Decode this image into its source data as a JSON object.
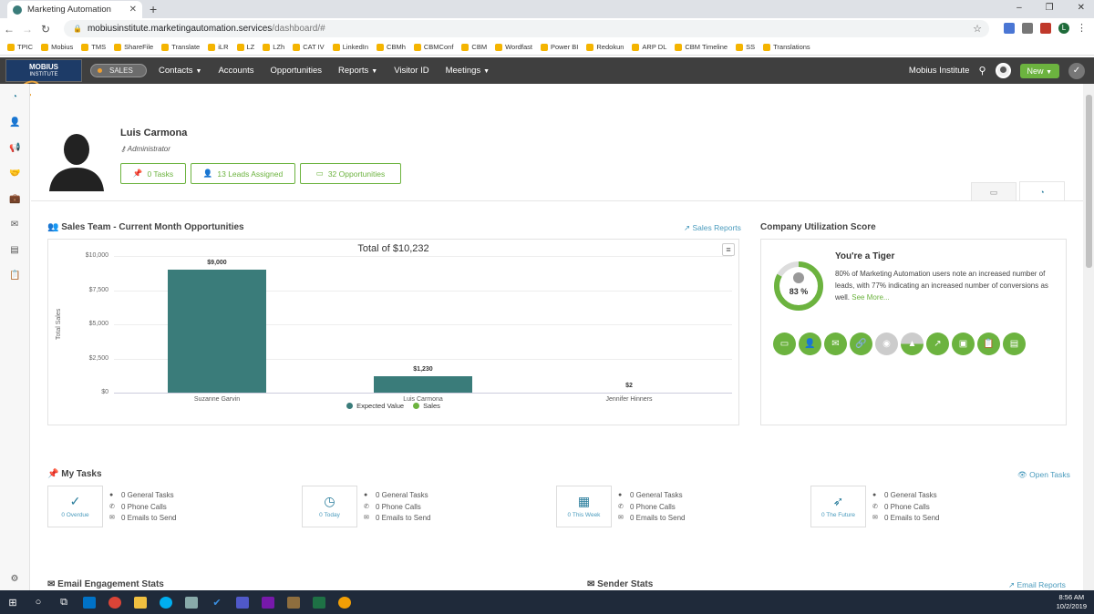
{
  "browser": {
    "tab_title": "Marketing Automation",
    "new_tab": "+",
    "window_controls": [
      "–",
      "❐",
      "✕"
    ],
    "url_host": "mobiusinstitute.marketingautomation.services",
    "url_path": "/dashboard/#",
    "bookmarks": [
      "TPIC",
      "Mobius",
      "TMS",
      "ShareFile",
      "Translate",
      "iLR",
      "LZ",
      "LZh",
      "CAT IV",
      "LinkedIn",
      "CBMh",
      "CBMConf",
      "CBM",
      "Wordfast",
      "Power BI",
      "Redokun",
      "ARP DL",
      "CBM Timeline",
      "SS",
      "Translations"
    ],
    "profile_initial": "L"
  },
  "appnav": {
    "logo_top": "MOBIUS",
    "logo_bottom": "INSTITUTE",
    "sales_pill": "SALES",
    "items": [
      "Contacts",
      "Accounts",
      "Opportunities",
      "Reports",
      "Visitor ID",
      "Meetings"
    ],
    "org": "Mobius Institute",
    "new_button": "New"
  },
  "profile": {
    "name": "Luis Carmona",
    "role": "Administrator",
    "tasks_btn": "0 Tasks",
    "leads_btn": "13 Leads Assigned",
    "opps_btn": "32 Opportunities"
  },
  "sales_team": {
    "title": "Sales Team - Current Month Opportunities",
    "link": "Sales Reports"
  },
  "chart_data": {
    "type": "bar",
    "title": "Total of $10,232",
    "ylabel": "Total Sales",
    "xlabel": "",
    "categories": [
      "Suzanne Garvin",
      "Luis Carmona",
      "Jennifer Hinners"
    ],
    "series": [
      {
        "name": "Expected Value",
        "values": [
          9000,
          1230,
          2
        ],
        "color": "#3a7c7a"
      },
      {
        "name": "Sales",
        "values": [
          0,
          0,
          0
        ],
        "color": "#6cb33f"
      }
    ],
    "data_labels": [
      "$9,000",
      "$1,230",
      "$2"
    ],
    "ylim": [
      0,
      10000
    ],
    "yticks": [
      "$0",
      "$2,500",
      "$5,000",
      "$7,500",
      "$10,000"
    ],
    "legend": "bottom"
  },
  "utilization": {
    "title": "Company Utilization Score",
    "percent_label": "83 %",
    "score": 0.83,
    "heading": "You're a Tiger",
    "text": "80% of Marketing Automation users note an increased number of leads, with 77% indicating an increased number of conversions as well.",
    "more": "See More..."
  },
  "tasks": {
    "title": "My Tasks",
    "link": "Open Tasks",
    "cards": [
      {
        "label": "0 Overdue",
        "icon": "✓",
        "general": "0 General Tasks",
        "calls": "0 Phone Calls",
        "emails": "0 Emails to Send"
      },
      {
        "label": "0 Today",
        "icon": "◷",
        "general": "0 General Tasks",
        "calls": "0 Phone Calls",
        "emails": "0 Emails to Send"
      },
      {
        "label": "0 This Week",
        "icon": "▦",
        "general": "0 General Tasks",
        "calls": "0 Phone Calls",
        "emails": "0 Emails to Send"
      },
      {
        "label": "0 The Future",
        "icon": "➶",
        "general": "0 General Tasks",
        "calls": "0 Phone Calls",
        "emails": "0 Emails to Send"
      }
    ]
  },
  "bottom": {
    "email_stats": "Email Engagement Stats",
    "sender_stats": "Sender Stats",
    "email_reports": "Email Reports"
  },
  "taskbar": {
    "time": "8:56 AM",
    "date": "10/2/2019"
  },
  "colors": {
    "accent_green": "#6cb33f",
    "bar_teal": "#3a7c7a",
    "link_blue": "#4a9bbd",
    "nav_dark": "#3f3f3f"
  }
}
